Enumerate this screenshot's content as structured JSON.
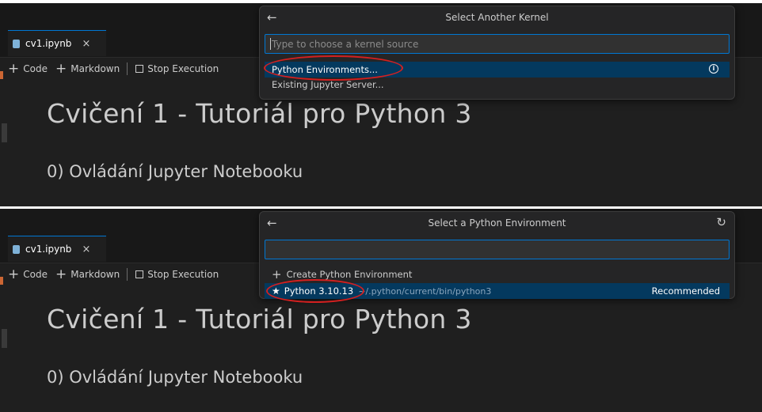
{
  "tab": {
    "label": "cv1.ipynb",
    "close": "×"
  },
  "toolbar": {
    "code_label": "Code",
    "markdown_label": "Markdown",
    "stop_label": "Stop Execution",
    "plus_glyph": "+"
  },
  "notebook": {
    "heading": "Cvičení 1 - Tutoriál pro Python 3",
    "subheading": "0) Ovládání Jupyter Notebooku"
  },
  "picker_top": {
    "title": "Select Another Kernel",
    "back_icon": "←",
    "placeholder": "Type to choose a kernel source",
    "items": [
      {
        "label": "Python Environments..."
      },
      {
        "label": "Existing Jupyter Server..."
      }
    ],
    "info_glyph": "i"
  },
  "picker_bottom": {
    "title": "Select a Python Environment",
    "back_icon": "←",
    "refresh_icon": "↻",
    "input_value": "",
    "create_label": "Create Python Environment",
    "env": {
      "name": "Python 3.10.13",
      "path": "~/.python/current/bin/python3",
      "badge": "Recommended",
      "star": "★"
    }
  },
  "colors": {
    "accent": "#0078d4",
    "selected": "#04395e",
    "highlight": "#d42020"
  }
}
